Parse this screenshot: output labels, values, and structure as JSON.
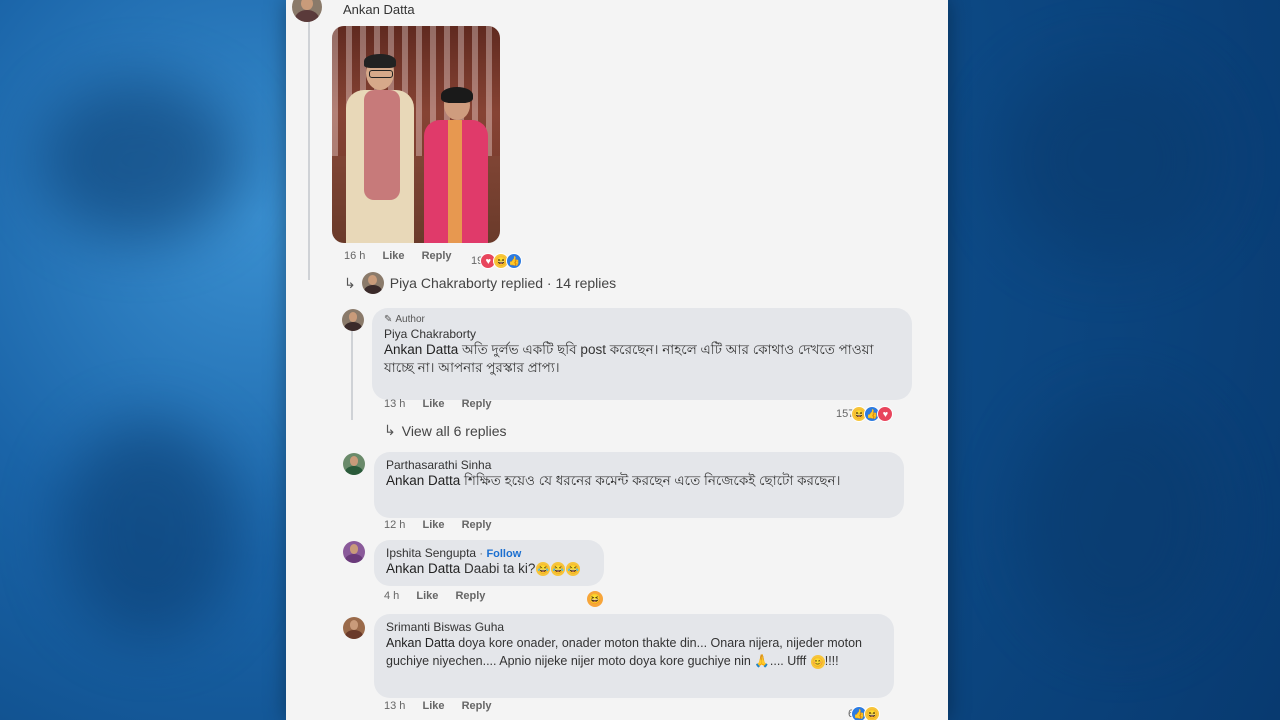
{
  "background_color": "#1a64a8",
  "post": {
    "author": "Ankan Datta",
    "time": "16 h",
    "like_label": "Like",
    "reply_label": "Reply",
    "reaction_count": "19",
    "reactions": [
      "love-icon",
      "haha-icon",
      "like-icon"
    ]
  },
  "replied_summary": "Piya Chakraborty replied · 14 replies",
  "comments": [
    {
      "author_tag": "Author",
      "name": "Piya Chakraborty",
      "mention": "Ankan Datta",
      "text": " অতি দুর্লভ একটি ছবি post করেছেন। নাহলে এটি আর কোথাও দেখতে পাওয়া যাচ্ছে না। আপনার পুরস্কার প্রাপ্য।",
      "time": "13 h",
      "like_label": "Like",
      "reply_label": "Reply",
      "reaction_count": "157",
      "view_replies": "View all 6 replies"
    },
    {
      "name": "Parthasarathi Sinha",
      "mention": "Ankan Datta",
      "text": " শিক্ষিত হয়েও যে ধরনের কমেন্ট করছেন এতে নিজেকেই ছোটো করছেন।",
      "time": "12 h",
      "like_label": "Like",
      "reply_label": "Reply"
    },
    {
      "name": "Ipshita Sengupta",
      "follow_label": "Follow",
      "mention": "Ankan Datta",
      "text": " Daabi ta ki?",
      "time": "4 h",
      "like_label": "Like",
      "reply_label": "Reply"
    },
    {
      "name": "Srimanti Biswas Guha",
      "mention": "Ankan Datta",
      "text": " doya kore onader, onader moton thakte din... Onara nijera, nijeder moton guchiye niyechen.... Apnio nijeke nijer moto doya kore guchiye nin",
      "text_end": ".... Ufff",
      "text_tail": "!!!!",
      "time": "13 h",
      "like_label": "Like",
      "reply_label": "Reply",
      "reaction_count": "6"
    }
  ]
}
